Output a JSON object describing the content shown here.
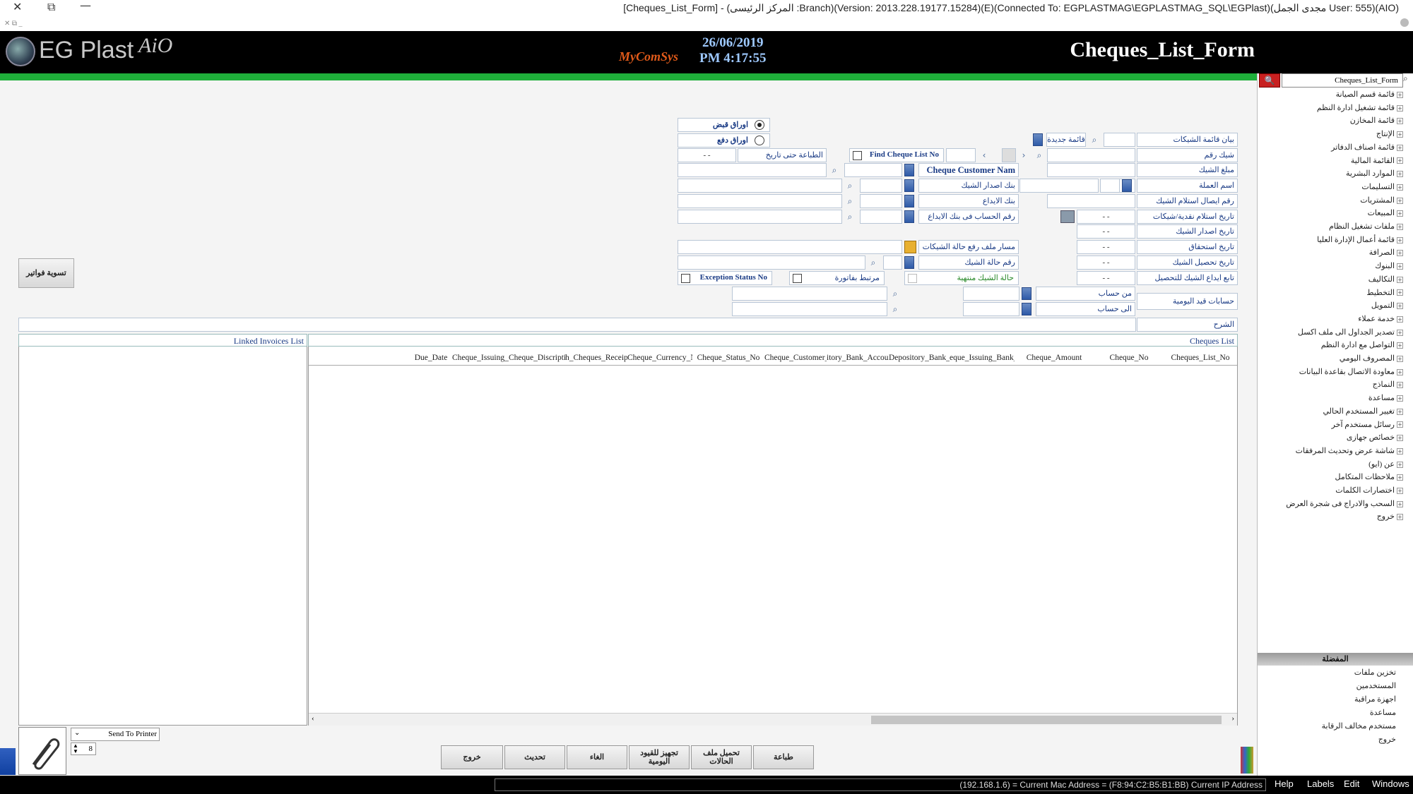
{
  "window": {
    "title": "[Cheques_List_Form] - (المركز الرئيسى :Branch)(Version: 2013.228.19177.15284)(E)(Connected To: EGPLASTMAG\\EGPLASTMAG_SQL\\EGPlast)(مجدى الجمل User: 555)(AIO)",
    "controls": {
      "close": "✕",
      "restore": "⧉",
      "minimize": "—"
    }
  },
  "header": {
    "logo_text": "EG Plast",
    "logo_aio": "AiO",
    "brand_small": "MyComSys",
    "date": "26/06/2019",
    "time": "PM 4:17:55",
    "form_title": "Cheques_List_Form"
  },
  "colors": {
    "header_bg": "#000000",
    "green_bar": "#1faf3a",
    "label_text": "#1a3b85",
    "search_red": "#c82020"
  },
  "right_panel": {
    "search_value": "Cheques_List_Form",
    "tree": [
      "قائمة قسم الصيانة",
      "قائمة تشغيل ادارة النظم",
      "قائمة المخازن",
      "الإنتاج",
      "قائمة اصناف الدفاتر",
      "القائمة المالية",
      "الموارد البشرية",
      "التسليمات",
      "المشتريات",
      "المبيعات",
      "ملفات تشغيل النظام",
      "قائمة أعمال الإدارة العليا",
      "الصرافة",
      "البنوك",
      "التكاليف",
      "التخطيط",
      "التمويل",
      "خدمة عملاء",
      "تصدير الجداول الى ملف اكسل",
      "التواصل مع ادارة النظم",
      "المصروف اليومي",
      "معاودة الاتصال بقاعدة البيانات",
      "النماذج",
      "مساعدة",
      "تغيير المستخدم الحالي",
      "رسائل مستخدم آخر",
      "خصائص جهازى",
      "شاشة عرض وتحديث المرفقات",
      "عن (ايو)",
      "ملاحظات المتكامل",
      "اختصارات الكلمات",
      "السحب والادراج فى شجرة العرض",
      "خروج"
    ],
    "favorites_title": "المفضلة",
    "favorites": [
      "تخزين ملفات",
      "المستخدمين",
      "اجهزة مراقبة",
      "مساعدة",
      "مستخدم مخالف الرقابة",
      "خروج"
    ]
  },
  "form": {
    "radio_receipt": "اوراق قبض",
    "radio_payment": "اوراق دفع",
    "print_until_date_label": "الطباعة حتى تاريخ",
    "print_until_date_value": "- -",
    "find_cheque_list_no": "Find Cheque List No",
    "new_list_button": "قائمة جديدة",
    "cheque_list_statement": "بيان قائمة الشيكات",
    "cheque_no": "شيك رقم",
    "cheque_amount": "مبلغ الشيك",
    "cheque_customer_name": "Cheque Customer Nam",
    "currency_name": "اسم العملة",
    "issuing_bank": "بنك اصدار الشيك",
    "receipt_no": "رقم ايصال استلام الشيك",
    "deposit_bank": "بنك الايداع",
    "receive_date": "تاريخ استلام نقدية/شيكات",
    "deposit_account_no": "رقم الحساب فى بنك الايداع",
    "issue_date": "تاريخ اصدار الشيك",
    "due_date": "تاريخ استحقاق",
    "status_file_path": "مسار ملف رفع حالة الشيكات",
    "collect_date": "تاريخ تحصيل الشيك",
    "status_no": "رقم حالة الشيك",
    "deposit_collect_date": "تابع ايداع الشيك للتحصيل",
    "status_closed": "حالة الشيك منتهية",
    "linked_invoice": "مرتبط بفاتورة",
    "exception_status_no": "Exception Status No",
    "journal_accounts": "حسابات قيد اليومية",
    "from_account": "من حساب",
    "to_account": "الى حساب",
    "notes": "الشرح",
    "empty_date": "- -"
  },
  "side_button": "تسوية فواتير",
  "cheques_list": {
    "title": "Cheques List",
    "columns": [
      "Cheques_List_No",
      "Cheque_No",
      "Cheque_Amount",
      "eque_Issuing_Bank_I",
      "Depository_Bank_Nc",
      "itory_Bank_Accour",
      "Cheque_Customer_Nc",
      "Cheque_Status_No",
      "Cheque_Currency_Nc",
      "h_Cheques_Receipt_",
      "Cheque_Discription",
      "Cheque_Issuing_Date",
      "Due_Date"
    ]
  },
  "linked_invoices": {
    "title": "Linked Invoices List"
  },
  "bottom": {
    "send_to_printer": "Send To Printer",
    "copies": "8",
    "buttons": [
      "طباعة",
      "تحميل ملف الحالات",
      "تجهيز للقيود اليومية",
      "الغاء",
      "تحديث",
      "خروج"
    ]
  },
  "status_bar": {
    "info": "(192.168.1.6) = Current Mac Address = (F8:94:C2:B5:B1:BB) Current IP Address",
    "menu": [
      "Help",
      "Labels",
      "Edit",
      "Windows"
    ]
  }
}
